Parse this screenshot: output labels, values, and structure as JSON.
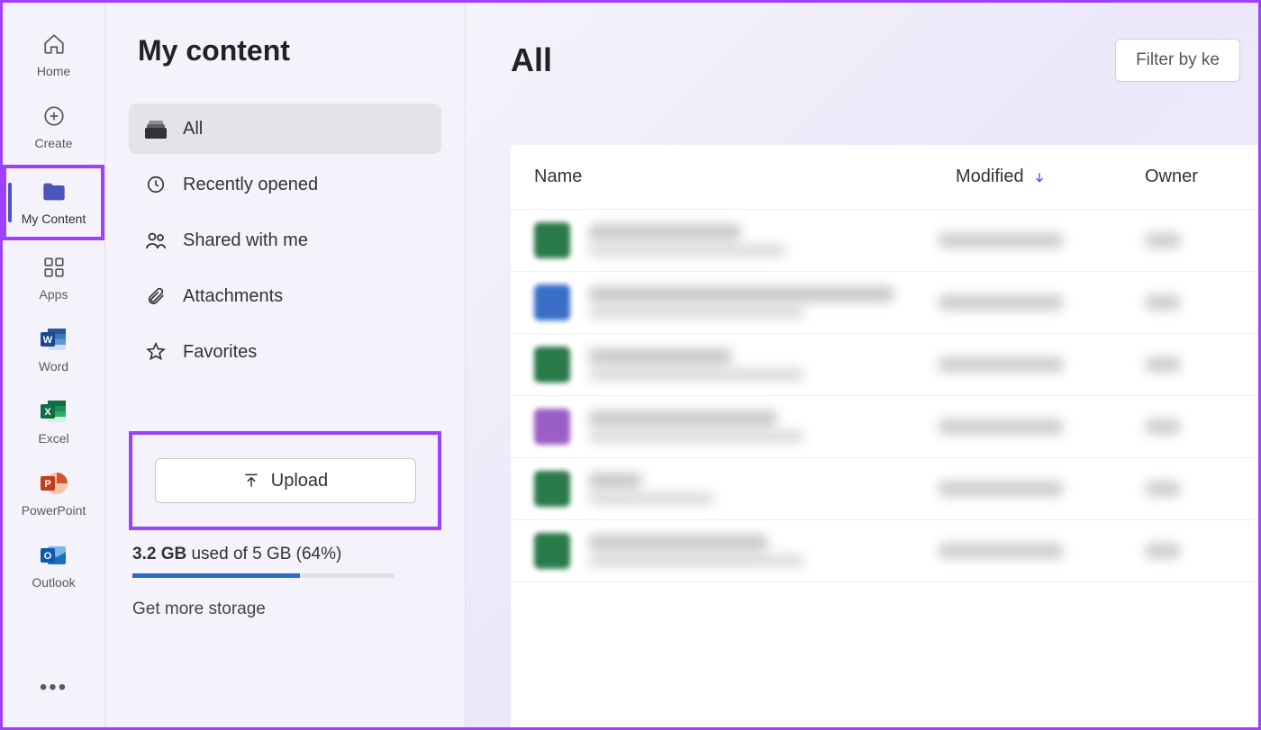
{
  "rail": {
    "items": [
      {
        "label": "Home"
      },
      {
        "label": "Create"
      },
      {
        "label": "My Content"
      },
      {
        "label": "Apps"
      },
      {
        "label": "Word"
      },
      {
        "label": "Excel"
      },
      {
        "label": "PowerPoint"
      },
      {
        "label": "Outlook"
      }
    ]
  },
  "panel": {
    "title": "My content",
    "nav": [
      {
        "label": "All"
      },
      {
        "label": "Recently opened"
      },
      {
        "label": "Shared with me"
      },
      {
        "label": "Attachments"
      },
      {
        "label": "Favorites"
      }
    ],
    "upload_label": "Upload",
    "storage_used": "3.2 GB",
    "storage_rest": " used of 5 GB (64%)",
    "storage_percent": 64,
    "storage_link": "Get more storage"
  },
  "main": {
    "heading": "All",
    "filter_label": "Filter by ke",
    "columns": {
      "name": "Name",
      "modified": "Modified",
      "owner": "Owner"
    },
    "rows": [
      {
        "color": "#2a7a4a",
        "w1": 170,
        "w2": 220
      },
      {
        "color": "#3a6fc7",
        "w1": 340,
        "w2": 240
      },
      {
        "color": "#2a7a4a",
        "w1": 160,
        "w2": 240
      },
      {
        "color": "#9a5fc7",
        "w1": 210,
        "w2": 240
      },
      {
        "color": "#2a7a4a",
        "w1": 60,
        "w2": 140
      },
      {
        "color": "#2a7a4a",
        "w1": 200,
        "w2": 240
      }
    ]
  }
}
